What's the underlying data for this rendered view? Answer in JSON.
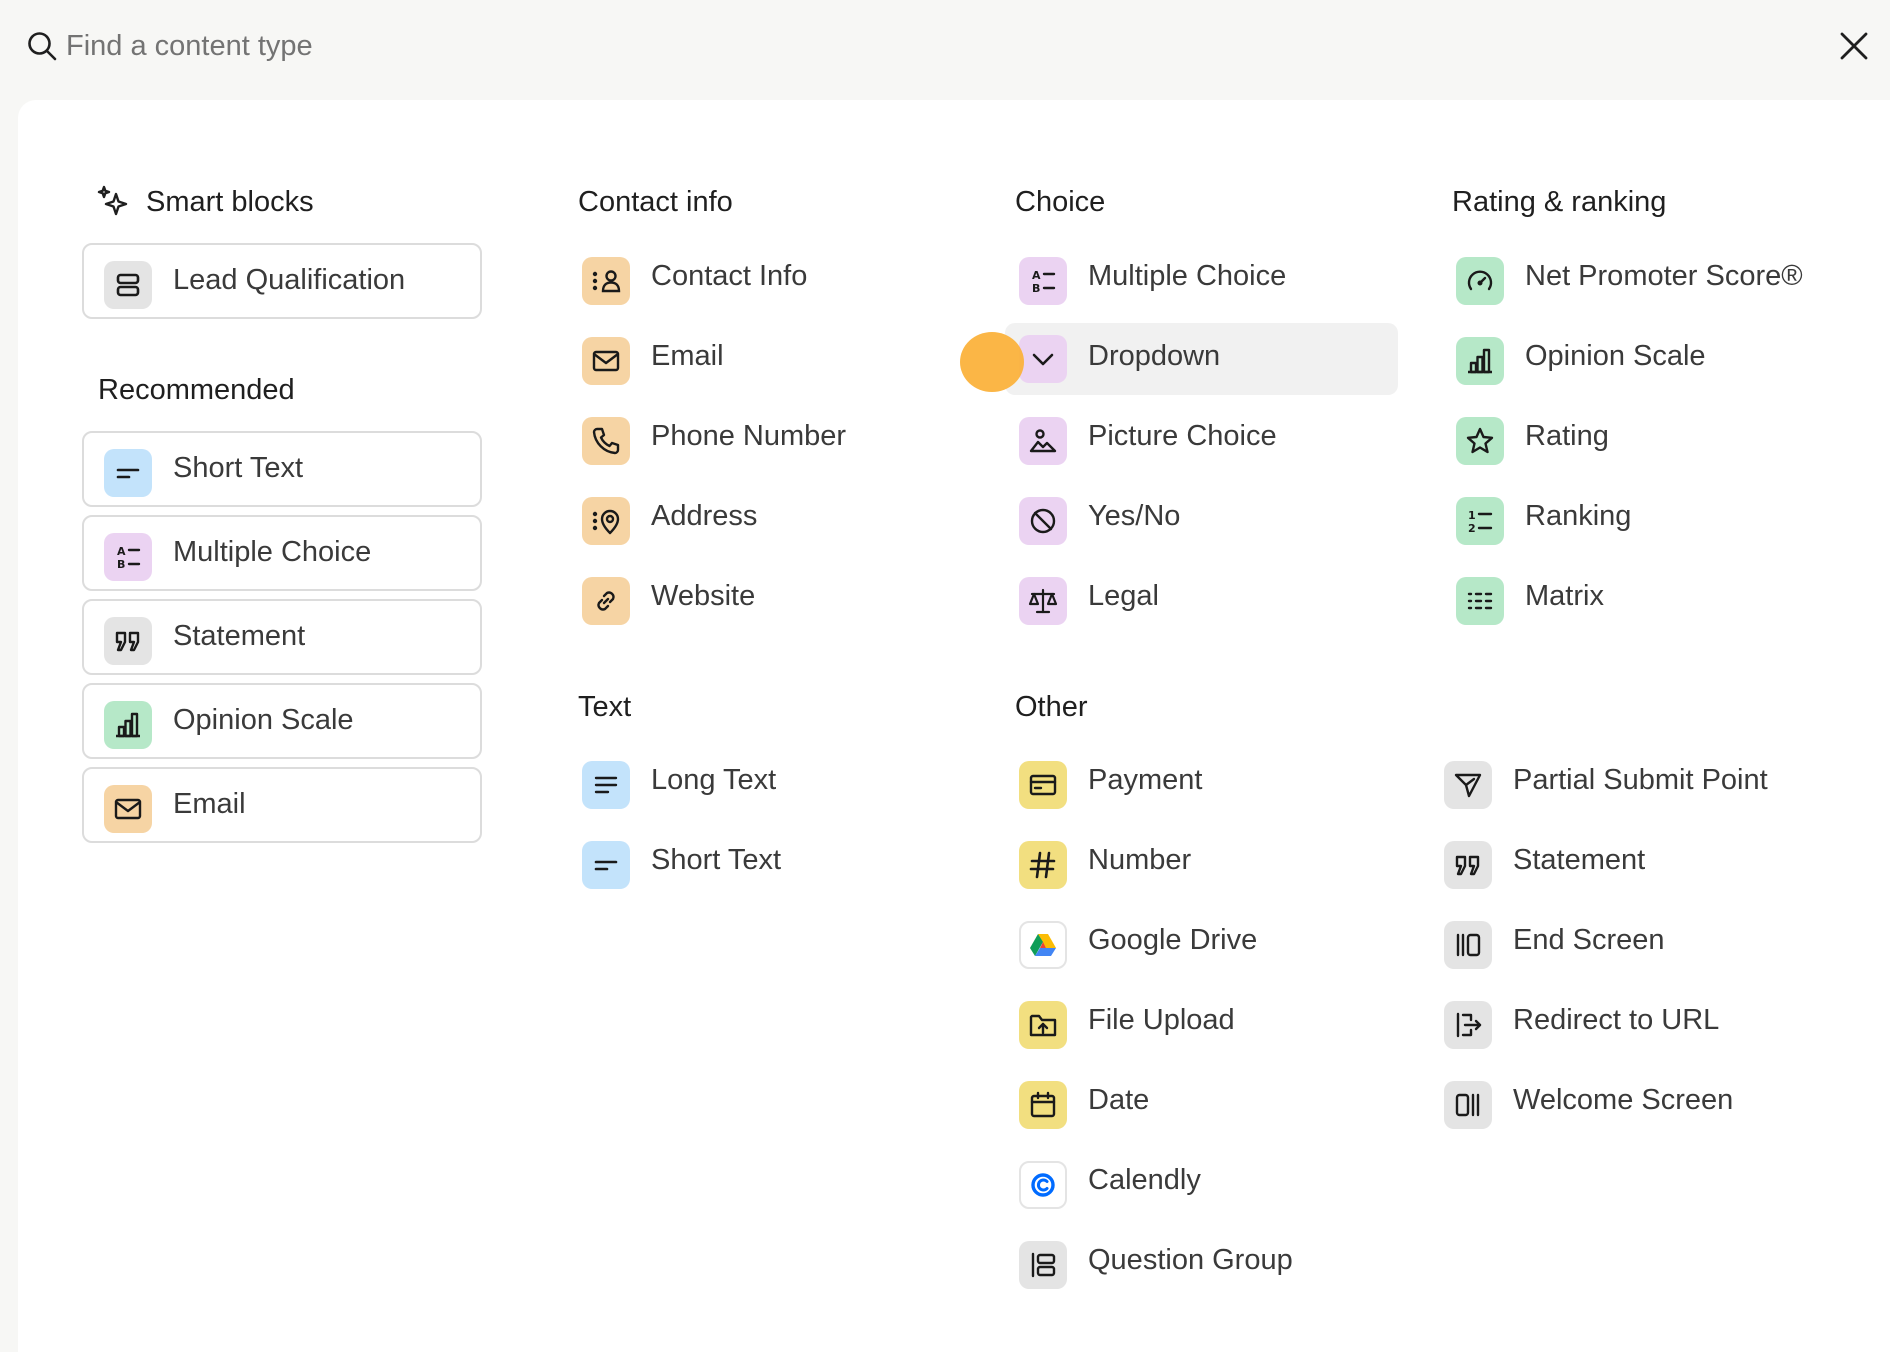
{
  "search": {
    "placeholder": "Find a content type"
  },
  "colors": {
    "blue": "#c3e3fb",
    "purple": "#ebd3f2",
    "orange": "#f6d4a4",
    "green": "#b6e8c8",
    "yellow": "#f2df80",
    "gray": "#e4e4e4",
    "cursor": "#fbb23c"
  },
  "smart_blocks": {
    "title": "Smart blocks",
    "items": [
      {
        "label": "Lead Qualification",
        "icon": "stack-icon"
      }
    ]
  },
  "recommended": {
    "title": "Recommended",
    "items": [
      {
        "label": "Short Text",
        "icon": "short-text-icon"
      },
      {
        "label": "Multiple Choice",
        "icon": "multiple-choice-icon"
      },
      {
        "label": "Statement",
        "icon": "quote-icon"
      },
      {
        "label": "Opinion Scale",
        "icon": "bar-chart-icon"
      },
      {
        "label": "Email",
        "icon": "envelope-icon"
      }
    ]
  },
  "contact_info": {
    "title": "Contact info",
    "items": [
      {
        "label": "Contact Info",
        "icon": "contact-card-icon"
      },
      {
        "label": "Email",
        "icon": "envelope-icon"
      },
      {
        "label": "Phone Number",
        "icon": "phone-icon"
      },
      {
        "label": "Address",
        "icon": "location-pin-icon"
      },
      {
        "label": "Website",
        "icon": "link-icon"
      }
    ]
  },
  "text": {
    "title": "Text",
    "items": [
      {
        "label": "Long Text",
        "icon": "long-text-icon"
      },
      {
        "label": "Short Text",
        "icon": "short-text-icon"
      }
    ]
  },
  "choice": {
    "title": "Choice",
    "items": [
      {
        "label": "Multiple Choice",
        "icon": "multiple-choice-icon"
      },
      {
        "label": "Dropdown",
        "icon": "chevron-down-icon",
        "state": "hovered"
      },
      {
        "label": "Picture Choice",
        "icon": "picture-icon"
      },
      {
        "label": "Yes/No",
        "icon": "yes-no-icon"
      },
      {
        "label": "Legal",
        "icon": "scales-icon"
      }
    ]
  },
  "other": {
    "title": "Other",
    "items": [
      {
        "label": "Payment",
        "icon": "credit-card-icon"
      },
      {
        "label": "Number",
        "icon": "hash-icon"
      },
      {
        "label": "Google Drive",
        "icon": "google-drive-icon"
      },
      {
        "label": "File Upload",
        "icon": "folder-upload-icon"
      },
      {
        "label": "Date",
        "icon": "calendar-icon"
      },
      {
        "label": "Calendly",
        "icon": "calendly-icon"
      },
      {
        "label": "Question Group",
        "icon": "question-group-icon"
      }
    ]
  },
  "rating_ranking": {
    "title": "Rating & ranking",
    "items": [
      {
        "label": "Net Promoter Score®",
        "icon": "gauge-icon"
      },
      {
        "label": "Opinion Scale",
        "icon": "bar-chart-icon"
      },
      {
        "label": "Rating",
        "icon": "star-icon"
      },
      {
        "label": "Ranking",
        "icon": "ranking-icon"
      },
      {
        "label": "Matrix",
        "icon": "matrix-icon"
      }
    ]
  },
  "other_right": {
    "items": [
      {
        "label": "Partial Submit Point",
        "icon": "send-icon"
      },
      {
        "label": "Statement",
        "icon": "quote-icon"
      },
      {
        "label": "End Screen",
        "icon": "end-screen-icon"
      },
      {
        "label": "Redirect to URL",
        "icon": "redirect-icon"
      },
      {
        "label": "Welcome Screen",
        "icon": "welcome-screen-icon"
      }
    ]
  }
}
